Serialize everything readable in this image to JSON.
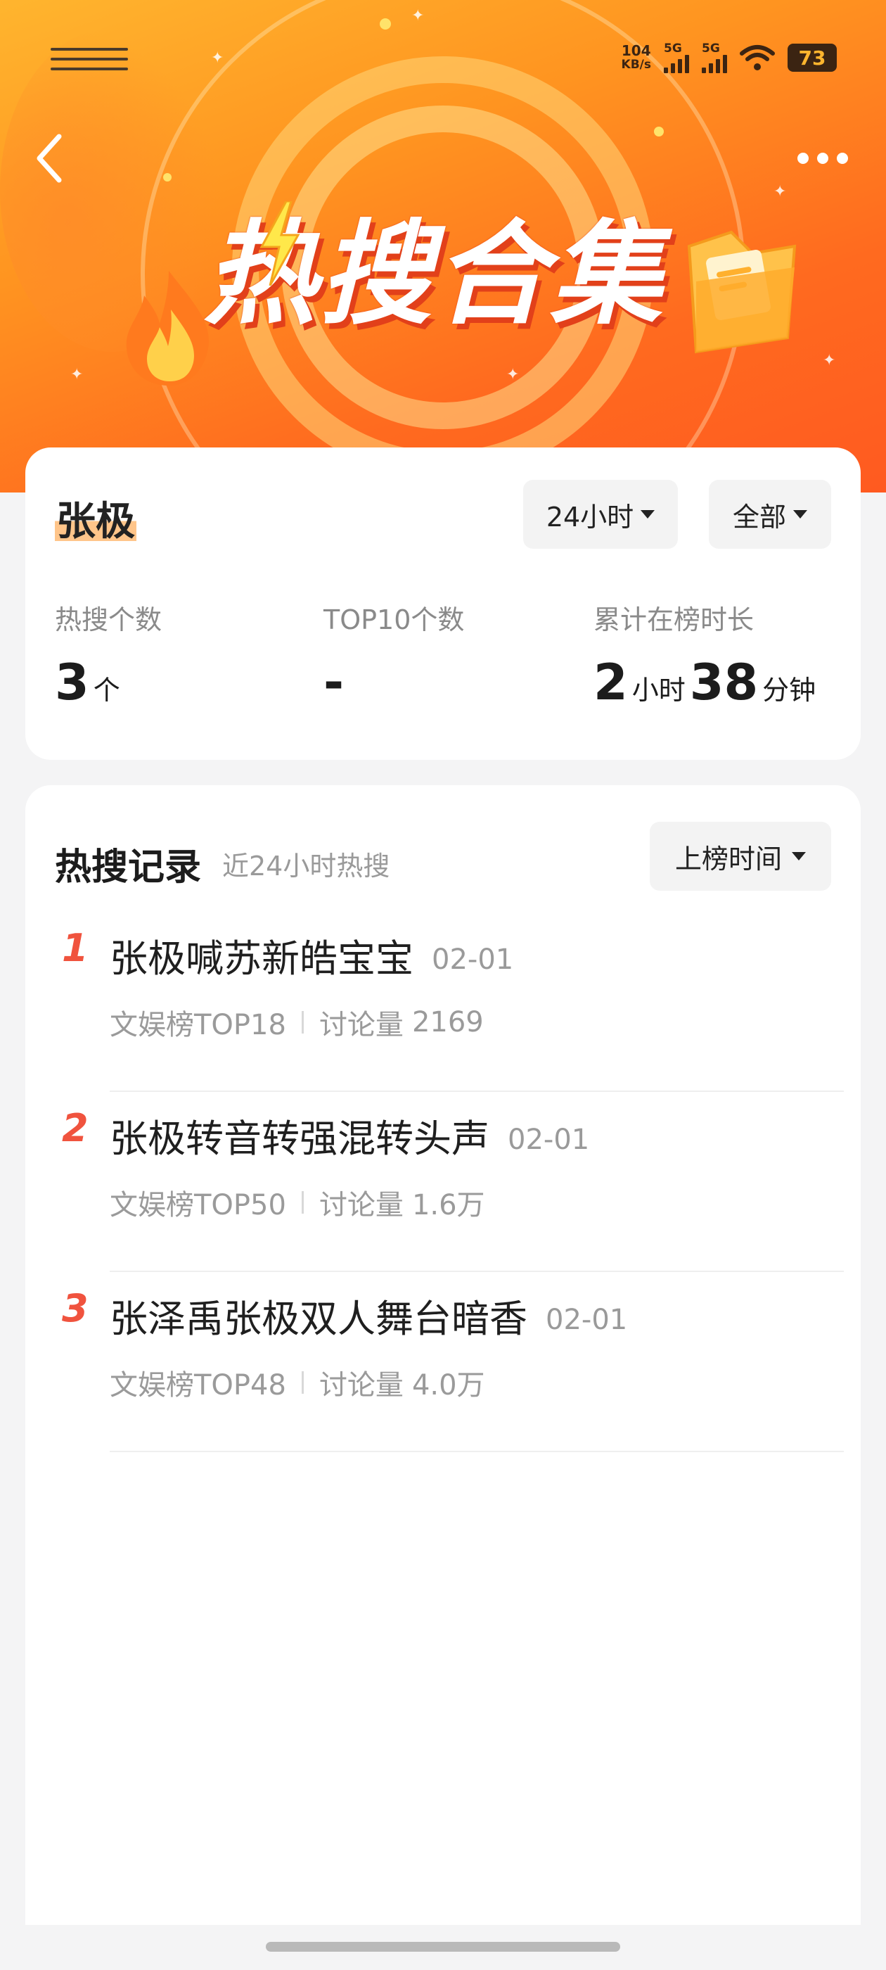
{
  "status_bar": {
    "net_speed_value": "104",
    "net_speed_unit": "KB/s",
    "sim1_label": "5G",
    "sim2_label": "5G",
    "battery": "73"
  },
  "header": {
    "banner_title": "热搜合集",
    "back_icon": "chevron-left-icon",
    "more_icon": "more-dots-icon"
  },
  "summary": {
    "name": "张极",
    "time_filter": "24小时",
    "scope_filter": "全部",
    "stats": [
      {
        "label": "热搜个数",
        "value": "3",
        "unit": "个"
      },
      {
        "label": "TOP10个数",
        "value": "-"
      },
      {
        "label": "累计在榜时长",
        "hours": "2",
        "hours_unit": "小时",
        "minutes": "38",
        "minutes_unit": "分钟"
      }
    ]
  },
  "records": {
    "title": "热搜记录",
    "subtitle": "近24小时热搜",
    "sort_label": "上榜时间",
    "items": [
      {
        "rank": "1",
        "topic": "张极喊苏新皓宝宝",
        "date": "02-01",
        "board": "文娱榜TOP18",
        "discussion_label": "讨论量",
        "discussion_value": "2169"
      },
      {
        "rank": "2",
        "topic": "张极转音转强混转头声",
        "date": "02-01",
        "board": "文娱榜TOP50",
        "discussion_label": "讨论量",
        "discussion_value": "1.6万"
      },
      {
        "rank": "3",
        "topic": "张泽禹张极双人舞台暗香",
        "date": "02-01",
        "board": "文娱榜TOP48",
        "discussion_label": "讨论量",
        "discussion_value": "4.0万"
      }
    ]
  },
  "colors": {
    "banner_start": "#ffb52e",
    "banner_end": "#ff5a20",
    "rank_red": "#f0533e",
    "name_highlight": "#ffc58a"
  }
}
